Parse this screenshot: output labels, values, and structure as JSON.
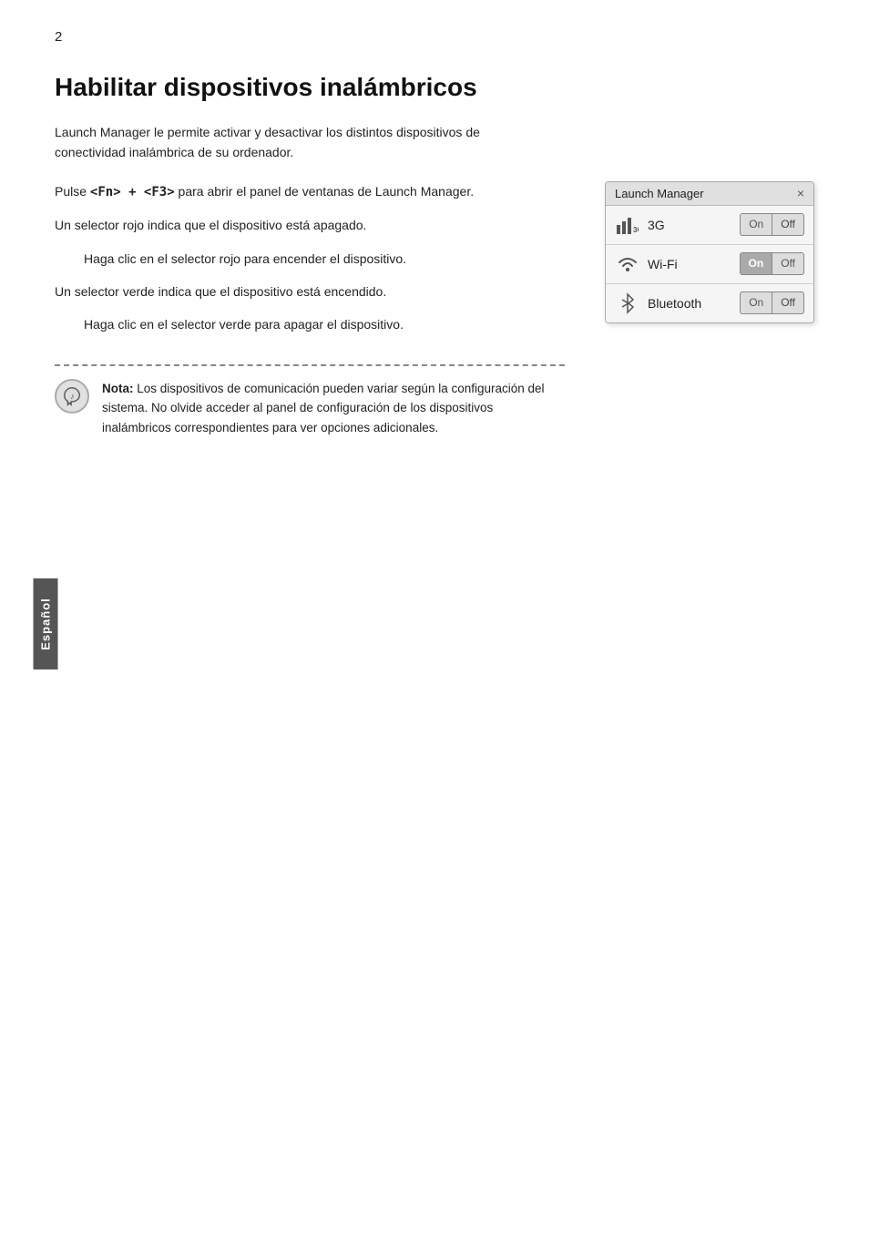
{
  "page": {
    "number": "2",
    "sidebar_label": "Español"
  },
  "title": "Habilitar dispositivos inalámbricos",
  "intro": "Launch Manager le permite activar y desactivar los distintos dispositivos de conectividad inalámbrica de su ordenador.",
  "paragraph1": "Pulse <Fn> + <F3> para abrir el panel de ventanas de Launch Manager.",
  "paragraph2": "Un selector rojo indica que el dispositivo está apagado.",
  "paragraph2_indented": "Haga clic en el selector rojo para encender el dispositivo.",
  "paragraph3": "Un selector verde indica que el dispositivo está encendido.",
  "paragraph3_indented": "Haga clic en el selector verde para apagar el dispositivo.",
  "launch_manager": {
    "title": "Launch Manager",
    "close_label": "×",
    "devices": [
      {
        "name": "3G",
        "icon": "3g",
        "on_label": "On",
        "off_label": "Off",
        "state": "off"
      },
      {
        "name": "Wi-Fi",
        "icon": "wifi",
        "on_label": "On",
        "off_label": "Off",
        "state": "on"
      },
      {
        "name": "Bluetooth",
        "icon": "bluetooth",
        "on_label": "On",
        "off_label": "Off",
        "state": "off"
      }
    ]
  },
  "note": {
    "prefix": "Nota:",
    "text": " Los dispositivos de comunicación pueden variar según la configuración del sistema. No olvide acceder al panel de configuración de los dispositivos inalámbricos correspondientes para ver opciones adicionales."
  }
}
